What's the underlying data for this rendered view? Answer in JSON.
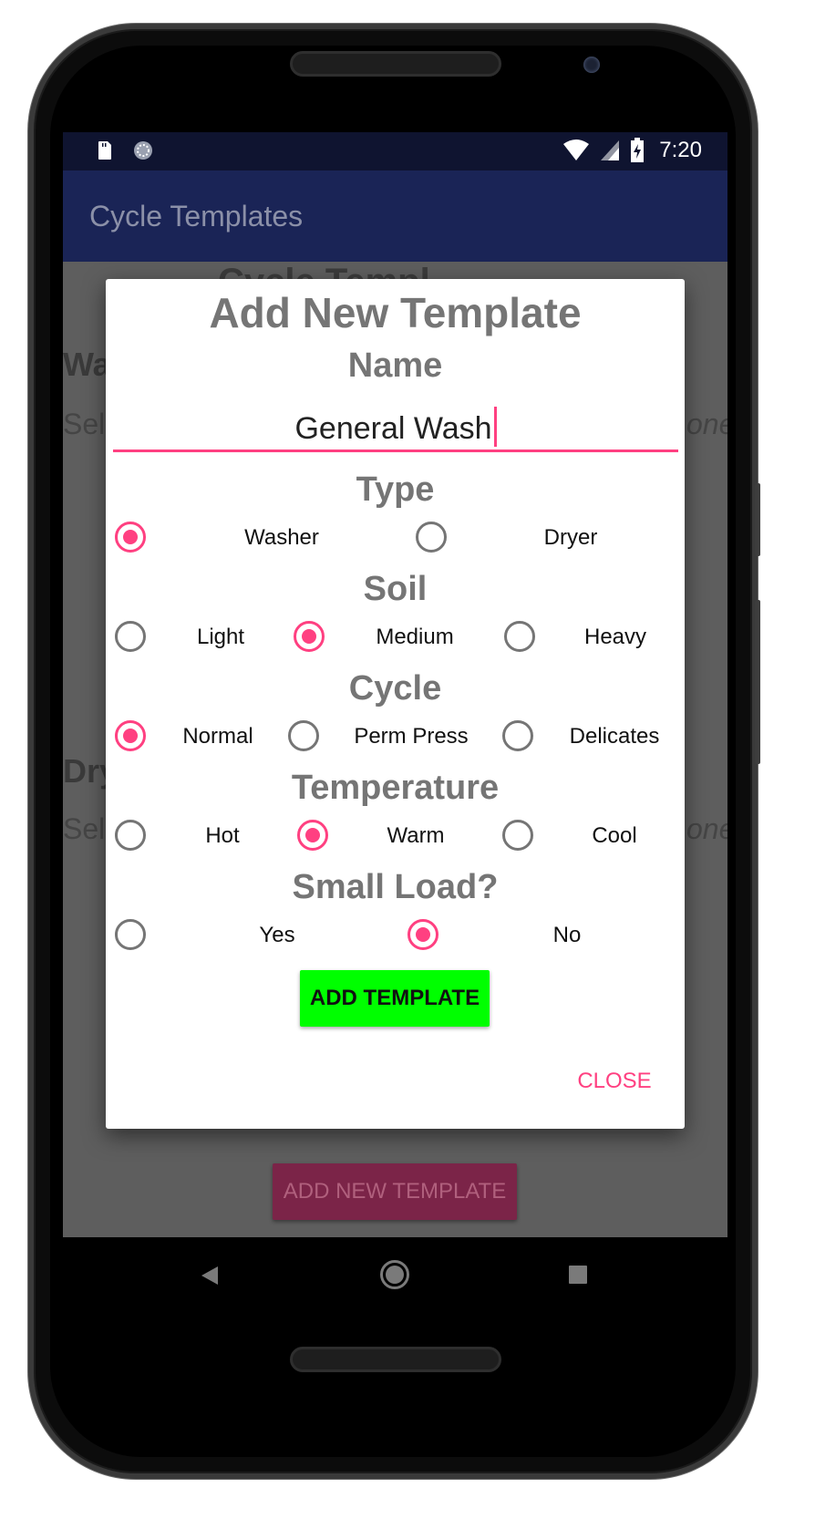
{
  "statusbar": {
    "time": "7:20",
    "icons_left": [
      "sd-card-icon",
      "sync-icon"
    ],
    "icons_right": [
      "wifi-icon",
      "cell-signal-icon",
      "battery-charging-icon"
    ]
  },
  "appbar": {
    "title": "Cycle Templates"
  },
  "background": {
    "heading_fragment": "Cycle Templ",
    "washer_fragment": "Wa",
    "washer_sub_fragment": "Sel",
    "washer_right_fragment": "one",
    "dryer_fragment": "Dry",
    "dryer_sub_fragment": "Sel",
    "dryer_right_fragment": "one",
    "add_new_template_label": "ADD NEW TEMPLATE"
  },
  "dialog": {
    "title": "Add New Template",
    "name_heading": "Name",
    "name_value": "General Wash",
    "type": {
      "heading": "Type",
      "options": [
        {
          "label": "Washer",
          "checked": true
        },
        {
          "label": "Dryer",
          "checked": false
        }
      ]
    },
    "soil": {
      "heading": "Soil",
      "options": [
        {
          "label": "Light",
          "checked": false
        },
        {
          "label": "Medium",
          "checked": true
        },
        {
          "label": "Heavy",
          "checked": false
        }
      ]
    },
    "cycle": {
      "heading": "Cycle",
      "options": [
        {
          "label": "Normal",
          "checked": true
        },
        {
          "label": "Perm Press",
          "checked": false
        },
        {
          "label": "Delicates",
          "checked": false
        }
      ]
    },
    "temperature": {
      "heading": "Temperature",
      "options": [
        {
          "label": "Hot",
          "checked": false
        },
        {
          "label": "Warm",
          "checked": true
        },
        {
          "label": "Cool",
          "checked": false
        }
      ]
    },
    "small_load": {
      "heading": "Small Load?",
      "options": [
        {
          "label": "Yes",
          "checked": false
        },
        {
          "label": "No",
          "checked": true
        }
      ]
    },
    "add_template_label": "ADD TEMPLATE",
    "close_label": "CLOSE"
  },
  "colors": {
    "accent": "#ff4081",
    "primary_dark": "#0f1430",
    "primary": "#1a2456",
    "add_button": "#00ff00"
  },
  "nav": {
    "icons": [
      "back-icon",
      "home-icon",
      "recents-icon"
    ]
  }
}
